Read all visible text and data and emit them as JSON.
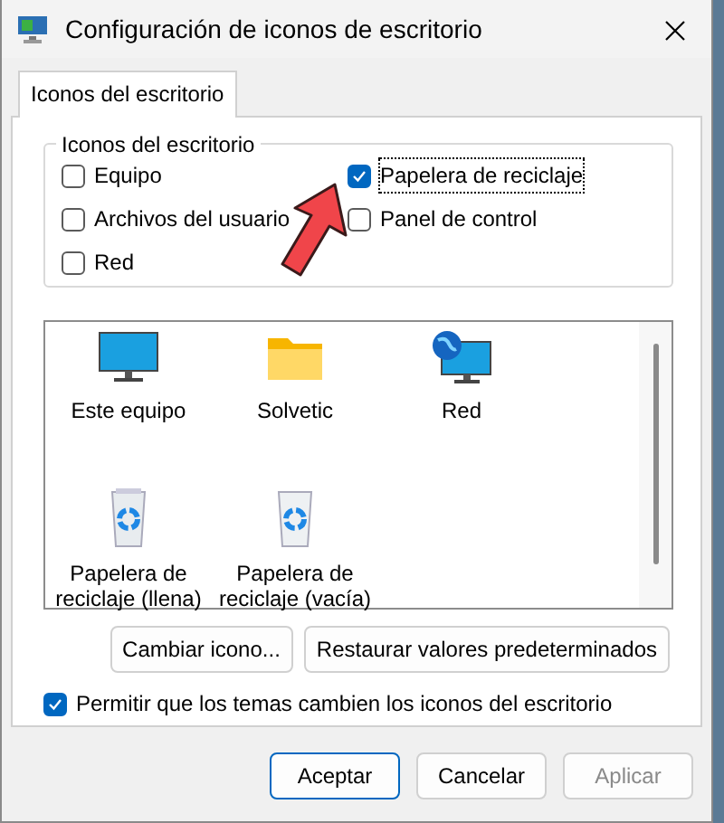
{
  "window": {
    "title": "Configuración de iconos de escritorio"
  },
  "tabs": [
    {
      "label": "Iconos del escritorio",
      "selected": true
    }
  ],
  "group": {
    "title": "Iconos del escritorio",
    "options": [
      {
        "label": "Equipo",
        "checked": false,
        "focused": false
      },
      {
        "label": "Papelera de reciclaje",
        "checked": true,
        "focused": true
      },
      {
        "label": "Archivos del usuario",
        "checked": false,
        "focused": false
      },
      {
        "label": "Panel de control",
        "checked": false,
        "focused": false
      },
      {
        "label": "Red",
        "checked": false,
        "focused": false
      }
    ]
  },
  "icons": [
    {
      "label": "Este equipo",
      "kind": "monitor"
    },
    {
      "label": "Solvetic",
      "kind": "folder"
    },
    {
      "label": "Red",
      "kind": "network"
    },
    {
      "label": "Papelera de reciclaje (llena)",
      "kind": "bin-full"
    },
    {
      "label": "Papelera de reciclaje (vacía)",
      "kind": "bin-empty"
    }
  ],
  "icon_buttons": [
    "Cambiar icono...",
    "Restaurar valores predeterminados"
  ],
  "allow_themes": {
    "label": "Permitir que los temas cambien los iconos del escritorio",
    "checked": true
  },
  "footer_buttons": [
    {
      "label": "Aceptar",
      "default": true,
      "disabled": false
    },
    {
      "label": "Cancelar",
      "default": false,
      "disabled": false
    },
    {
      "label": "Aplicar",
      "default": false,
      "disabled": true
    }
  ]
}
